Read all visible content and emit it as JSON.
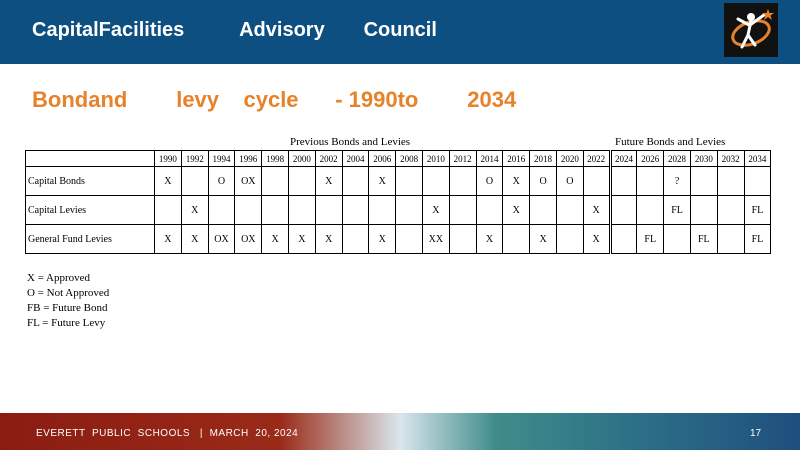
{
  "header": {
    "title": "CapitalFacilities          Advisory       Council"
  },
  "subtitle": "Bondand        levy    cycle      - 1990to        2034",
  "table": {
    "previous_header": "Previous Bonds and Levies",
    "future_header": "Future Bonds and Levies",
    "years": [
      "1990",
      "1992",
      "1994",
      "1996",
      "1998",
      "2000",
      "2002",
      "2004",
      "2006",
      "2008",
      "2010",
      "2012",
      "2014",
      "2016",
      "2018",
      "2020",
      "2022",
      "2024",
      "2026",
      "2028",
      "2030",
      "2032",
      "2034"
    ],
    "rows": [
      {
        "label": "Capital Bonds",
        "cells": [
          "X",
          "",
          "O",
          "OX",
          "",
          "",
          "X",
          "",
          "X",
          "",
          "",
          "",
          "O",
          "X",
          "O",
          "O",
          "",
          "",
          "",
          "?",
          "",
          "",
          ""
        ]
      },
      {
        "label": "Capital Levies",
        "cells": [
          "",
          "X",
          "",
          "",
          "",
          "",
          "",
          "",
          "",
          "",
          "X",
          "",
          "",
          "X",
          "",
          "",
          "X",
          "",
          "",
          "FL",
          "",
          "",
          "FL"
        ]
      },
      {
        "label": "General Fund Levies",
        "cells": [
          "X",
          "X",
          "OX",
          "OX",
          "X",
          "X",
          "X",
          "",
          "X",
          "",
          "XX",
          "",
          "X",
          "",
          "X",
          "",
          "X",
          "",
          "FL",
          "",
          "FL",
          "",
          "FL"
        ]
      }
    ]
  },
  "legend": [
    "X = Approved",
    "O = Not Approved",
    "FB = Future Bond",
    "FL = Future Levy"
  ],
  "footer": {
    "text": "EVERETT  PUBLIC  SCHOOLS   |  MARCH  20, 2024",
    "page": "17"
  },
  "colors": {
    "header_bg": "#0d4f80",
    "subtitle": "#e8822a"
  }
}
